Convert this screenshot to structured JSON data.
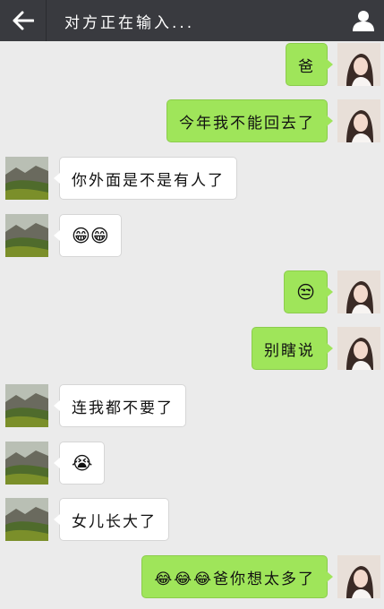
{
  "header": {
    "title": "对方正在输入...",
    "back_icon": "arrow-left-icon",
    "profile_icon": "person-icon"
  },
  "colors": {
    "topbar": "#393a3f",
    "background": "#ebebeb",
    "outgoing_bubble": "#9fe55a",
    "incoming_bubble": "#ffffff"
  },
  "messages": [
    {
      "side": "out",
      "text": "爸"
    },
    {
      "side": "out",
      "text": "今年我不能回去了"
    },
    {
      "side": "in",
      "text": "你外面是不是有人了"
    },
    {
      "side": "in",
      "text": "😁😁"
    },
    {
      "side": "out",
      "text": "😒"
    },
    {
      "side": "out",
      "text": "别瞎说"
    },
    {
      "side": "in",
      "text": "连我都不要了"
    },
    {
      "side": "in",
      "text": "😭"
    },
    {
      "side": "in",
      "text": "女儿长大了"
    },
    {
      "side": "out",
      "text": "😂😂😂爸你想太多了"
    }
  ]
}
